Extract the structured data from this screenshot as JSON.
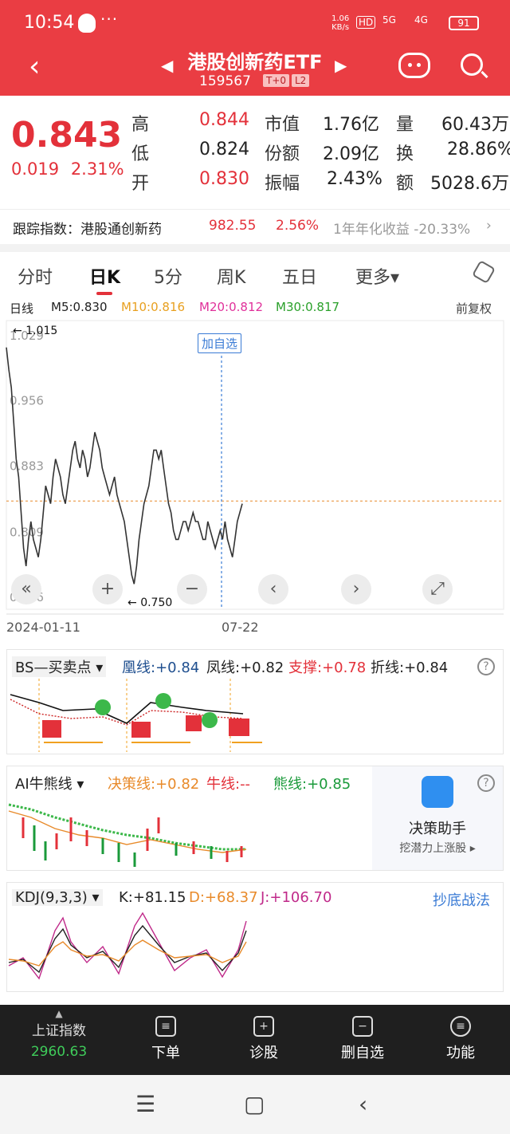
{
  "status": {
    "time": "10:54",
    "dots": "···",
    "net_speed": "1.06",
    "net_unit": "KB/s",
    "hd": "HD",
    "sig1": "5G",
    "sig2": "4G",
    "battery": "91"
  },
  "header": {
    "title": "港股创新药ETF",
    "code": "159567",
    "tag1": "T+0",
    "tag2": "L2"
  },
  "quote": {
    "price": "0.843",
    "change": "0.019",
    "change_pct": "2.31%",
    "rows": [
      {
        "l1": "高",
        "v1": "0.844",
        "l2": "市值",
        "v2": "1.76亿",
        "l3": "量",
        "v3": "60.43万"
      },
      {
        "l1": "低",
        "v1": "0.824",
        "l2": "份额",
        "v2": "2.09亿",
        "l3": "换",
        "v3": "28.86%"
      },
      {
        "l1": "开",
        "v1": "0.830",
        "l2": "振幅",
        "v2": "2.43%",
        "l3": "额",
        "v3": "5028.6万"
      }
    ]
  },
  "tracking": {
    "label": "跟踪指数：港股通创新药",
    "value": "982.55",
    "pct": "2.56%",
    "annual": "1年年化收益 -20.33%",
    "arrow": "›"
  },
  "tabs": [
    "分时",
    "日K",
    "5分",
    "周K",
    "五日",
    "更多▾"
  ],
  "ma": {
    "type": "日线",
    "m5": "M5:0.830",
    "m10": "M10:0.816",
    "m20": "M20:0.812",
    "m30": "M30:0.817",
    "adj": "前复权",
    "colors": {
      "m5": "#222222",
      "m10": "#e8a020",
      "m20": "#e0309a",
      "m30": "#2aa02a"
    }
  },
  "chart_data": {
    "type": "line",
    "title": "",
    "x_start": "2024-01-11",
    "x_mark": "07-22",
    "ylim": [
      0.736,
      1.029
    ],
    "yticks": [
      "1.029",
      "0.956",
      "0.883",
      "0.809",
      "0.736"
    ],
    "high_label": "1.015",
    "low_label": "0.750",
    "current": 0.843,
    "add_watch": "加自选",
    "series": [
      {
        "values": [
          1.015,
          0.99,
          0.97,
          0.93,
          0.89,
          0.87,
          0.83,
          0.79,
          0.77,
          0.8,
          0.82,
          0.8,
          0.79,
          0.78,
          0.8,
          0.83,
          0.86,
          0.85,
          0.84,
          0.87,
          0.89,
          0.88,
          0.87,
          0.85,
          0.84,
          0.86,
          0.88,
          0.9,
          0.91,
          0.89,
          0.88,
          0.9,
          0.89,
          0.87,
          0.88,
          0.9,
          0.92,
          0.91,
          0.9,
          0.88,
          0.87,
          0.86,
          0.85,
          0.86,
          0.87,
          0.85,
          0.84,
          0.83,
          0.82,
          0.8,
          0.78,
          0.76,
          0.75,
          0.77,
          0.8,
          0.82,
          0.84,
          0.85,
          0.86,
          0.88,
          0.9,
          0.9,
          0.89,
          0.9,
          0.88,
          0.86,
          0.84,
          0.83,
          0.81,
          0.8,
          0.8,
          0.81,
          0.82,
          0.82,
          0.81,
          0.82,
          0.83,
          0.82,
          0.82,
          0.81,
          0.8,
          0.8,
          0.82,
          0.81,
          0.8,
          0.79,
          0.8,
          0.81,
          0.8,
          0.82,
          0.8,
          0.79,
          0.78,
          0.8,
          0.82,
          0.83,
          0.84
        ]
      }
    ]
  },
  "bs_panel": {
    "title": "BS—买卖点",
    "l1": "凰线:+0.84",
    "l2": "凤线:+0.82",
    "l3": "支撑:+0.78",
    "l4": "折线:+0.84"
  },
  "ai_panel": {
    "title": "AI牛熊线",
    "l1": "决策线:+0.82",
    "l2": "牛线:-- ",
    "l3": "熊线:+0.85",
    "assist_title": "决策助手",
    "assist_sub": "挖潜力上涨股 ▸"
  },
  "kdj_panel": {
    "title": "KDJ(9,3,3)",
    "k": "K:+81.15",
    "d": "D:+68.37",
    "j": "J:+106.70",
    "link": "抄底战法"
  },
  "toolbar": {
    "index_name": "上证指数",
    "index_value": "2960.63",
    "order": "下单",
    "diag": "诊股",
    "del_watch": "删自选",
    "func": "功能"
  },
  "navbar": {
    "menu": "☰",
    "home": "▢",
    "back": "‹"
  }
}
